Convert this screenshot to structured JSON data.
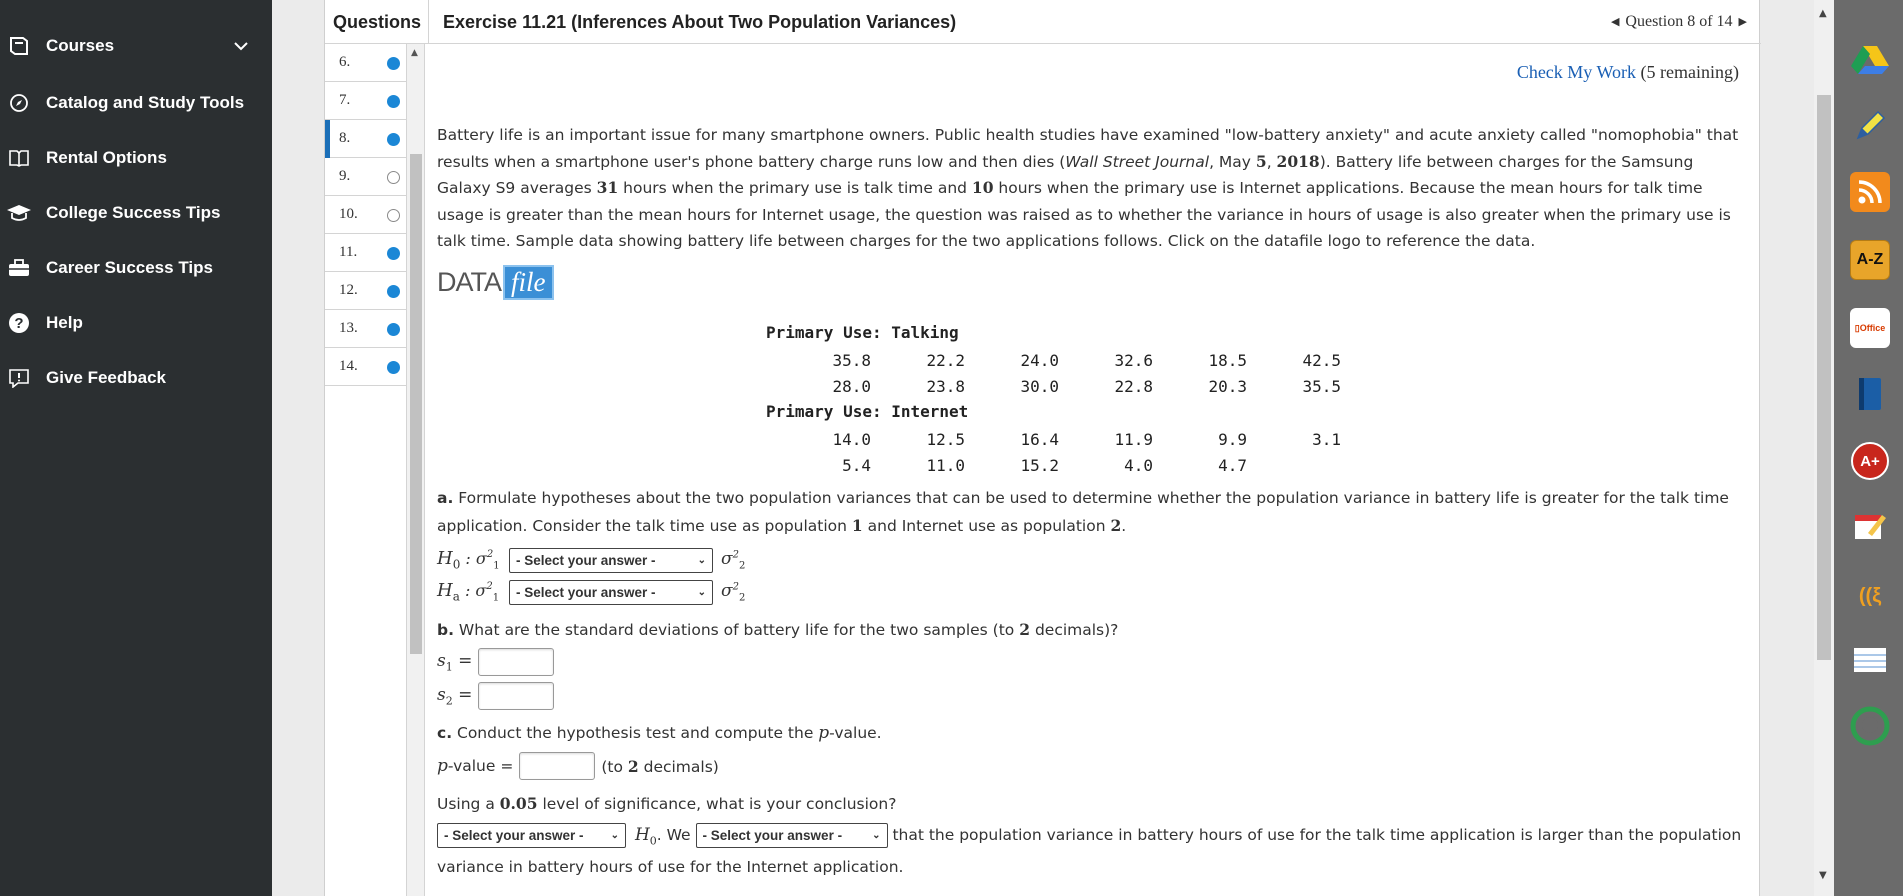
{
  "nav": {
    "items": [
      {
        "label": "Courses",
        "icon": "book-icon"
      },
      {
        "label": "Catalog and Study Tools",
        "icon": "compass-icon"
      },
      {
        "label": "Rental Options",
        "icon": "open-book-icon"
      },
      {
        "label": "College Success Tips",
        "icon": "graduation-cap-icon"
      },
      {
        "label": "Career Success Tips",
        "icon": "briefcase-icon"
      },
      {
        "label": "Help",
        "icon": "help-icon"
      },
      {
        "label": "Give Feedback",
        "icon": "feedback-icon"
      }
    ]
  },
  "header": {
    "questions_label": "Questions",
    "exercise_title": "Exercise 11.21 (Inferences About Two Population Variances)",
    "question_position": "Question 8 of 14"
  },
  "question_list": [
    {
      "num": "6.",
      "status": "done"
    },
    {
      "num": "7.",
      "status": "done"
    },
    {
      "num": "8.",
      "status": "done",
      "active": true
    },
    {
      "num": "9.",
      "status": "open"
    },
    {
      "num": "10.",
      "status": "open"
    },
    {
      "num": "11.",
      "status": "done"
    },
    {
      "num": "12.",
      "status": "done"
    },
    {
      "num": "13.",
      "status": "done"
    },
    {
      "num": "14.",
      "status": "done"
    }
  ],
  "check": {
    "link": "Check My Work",
    "remaining": "(5 remaining)"
  },
  "intro": {
    "p1": "Battery life is an important issue for many smartphone owners. Public health studies have examined \"low-battery anxiety\" and acute anxiety called \"nomophobia\" that results when a smartphone user's phone battery charge runs low and then dies (",
    "source": "Wall Street Journal",
    "p2": ", May ",
    "day": "5",
    "p3": ", ",
    "year": "2018",
    "p4": "). Battery life between charges for the Samsung Galaxy S9 averages ",
    "talk_hours": "31",
    "p5": " hours when the primary use is talk time and ",
    "net_hours": "10",
    "p6": " hours when the primary use is Internet applications. Because the mean hours for talk time usage is greater than the mean hours for Internet usage, the question was raised as to whether the variance in hours of usage is also greater when the primary use is talk time. Sample data showing battery life between charges for the two applications follows. Click on the datafile logo to reference the data."
  },
  "datafile": {
    "part1": "DATA",
    "part2": "file"
  },
  "table": {
    "talking_title": "Primary Use: Talking",
    "talking_rows": [
      [
        "35.8",
        "22.2",
        "24.0",
        "32.6",
        "18.5",
        "42.5"
      ],
      [
        "28.0",
        "23.8",
        "30.0",
        "22.8",
        "20.3",
        "35.5"
      ]
    ],
    "internet_title": "Primary Use: Internet",
    "internet_rows": [
      [
        "14.0",
        "12.5",
        "16.4",
        "11.9",
        "9.9",
        "3.1"
      ],
      [
        "5.4",
        "11.0",
        "15.2",
        "4.0",
        "4.7"
      ]
    ]
  },
  "part_a": {
    "letter": "a.",
    "text1": " Formulate hypotheses about the two population variances that can be used to determine whether the population variance in battery life is greater for the talk time application. Consider the talk time use as population ",
    "pop1": "1",
    "text2": " and Internet use as population ",
    "pop2": "2",
    "text3": ".",
    "h0_label": "H",
    "h0_sub": "0",
    "ha_label": "H",
    "ha_sub": "a",
    "colon": " : σ",
    "select_placeholder": "- Select your answer -"
  },
  "part_b": {
    "letter": "b.",
    "text1": " What are the standard deviations of battery life for the two samples (to ",
    "decimals": "2",
    "text2": " decimals)?",
    "s1_label": "s",
    "s1_sub": "1",
    "s2_label": "s",
    "s2_sub": "2",
    "eq": " ="
  },
  "part_c": {
    "letter": "c.",
    "text1": " Conduct the hypothesis test and compute the ",
    "p": "p",
    "text2": "-value.",
    "pvalue_label": "-value =",
    "pvalue_hint1": "(to ",
    "pvalue_hint_dec": "2",
    "pvalue_hint2": " decimals)",
    "sig1": "Using a ",
    "alpha": "0.05",
    "sig2": " level of significance, what is your conclusion?",
    "concl_select1": "- Select your answer -",
    "h0": "H",
    "h0_sub": "0",
    "we": ". We ",
    "concl_select2": "- Select your answer -",
    "concl_text": " that the population variance in battery hours of use for the talk time application is larger than the population variance in battery hours of use for the Internet application."
  },
  "dock": [
    {
      "name": "google-drive-icon",
      "color": "#2e9e4f",
      "glyph": "▲"
    },
    {
      "name": "pencil-icon",
      "color": "#e9d93b",
      "glyph": "✎"
    },
    {
      "name": "rss-icon",
      "color": "#f28a1c",
      "glyph": "◉"
    },
    {
      "name": "a-z-icon",
      "color": "#e8a52a",
      "glyph": "A-Z"
    },
    {
      "name": "office-icon",
      "color": "#ffffff",
      "glyph": "Office"
    },
    {
      "name": "book-icon",
      "color": "#1a4f8a",
      "glyph": "▮"
    },
    {
      "name": "a-plus-icon",
      "color": "#c8261c",
      "glyph": "A+"
    },
    {
      "name": "notes-icon",
      "color": "#f4c44a",
      "glyph": "✎"
    },
    {
      "name": "speech-icon",
      "color": "#f0a020",
      "glyph": "((ξ"
    },
    {
      "name": "notebook-icon",
      "color": "#ffffff",
      "glyph": "≡"
    },
    {
      "name": "green-circle-icon",
      "color": "#2e9e4f",
      "glyph": "◯"
    }
  ]
}
